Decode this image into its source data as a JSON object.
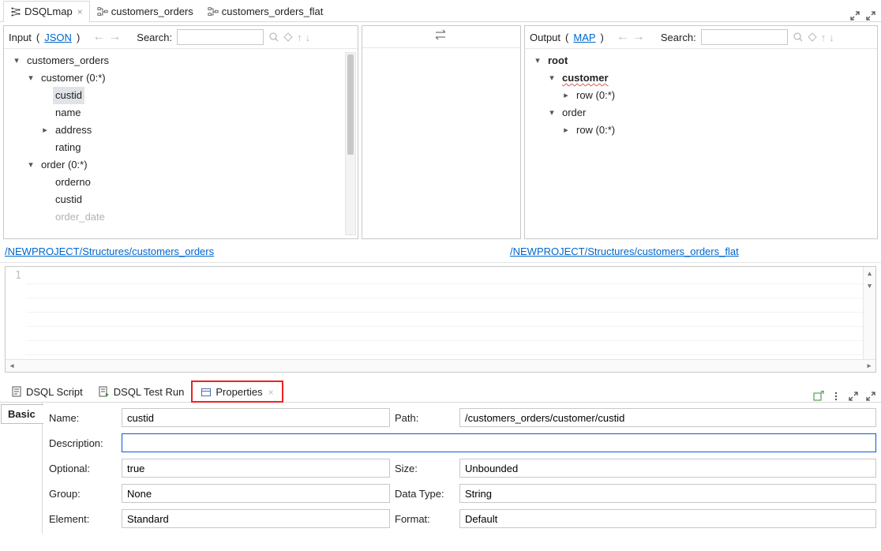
{
  "top_tabs": {
    "t0": "DSQLmap",
    "t1": "customers_orders",
    "t2": "customers_orders_flat"
  },
  "input_panel": {
    "label": "Input",
    "type_link": "JSON",
    "search_label": "Search:",
    "search_value": "",
    "tree": {
      "root": "customers_orders",
      "customer": "customer (0:*)",
      "custid": "custid",
      "name": "name",
      "address": "address",
      "rating": "rating",
      "order": "order (0:*)",
      "orderno": "orderno",
      "o_custid": "custid",
      "order_date": "order_date"
    },
    "path_link": "/NEWPROJECT/Structures/customers_orders"
  },
  "output_panel": {
    "label": "Output",
    "type_link": "MAP",
    "search_label": "Search:",
    "search_value": "",
    "tree": {
      "root": "root",
      "customer": "customer",
      "customer_row": "row (0:*)",
      "order": "order",
      "order_row": "row (0:*)"
    },
    "path_link": "/NEWPROJECT/Structures/customers_orders_flat"
  },
  "editor": {
    "line_no": "1"
  },
  "lower_tabs": {
    "t0": "DSQL Script",
    "t1": "DSQL Test Run",
    "t2": "Properties"
  },
  "side_tab": "Basic",
  "properties": {
    "name_lbl": "Name:",
    "name_val": "custid",
    "path_lbl": "Path:",
    "path_val": "/customers_orders/customer/custid",
    "desc_lbl": "Description:",
    "desc_val": "",
    "optional_lbl": "Optional:",
    "optional_val": "true",
    "size_lbl": "Size:",
    "size_val": "Unbounded",
    "group_lbl": "Group:",
    "group_val": "None",
    "datatype_lbl": "Data Type:",
    "datatype_val": "String",
    "element_lbl": "Element:",
    "element_val": "Standard",
    "format_lbl": "Format:",
    "format_val": "Default"
  }
}
